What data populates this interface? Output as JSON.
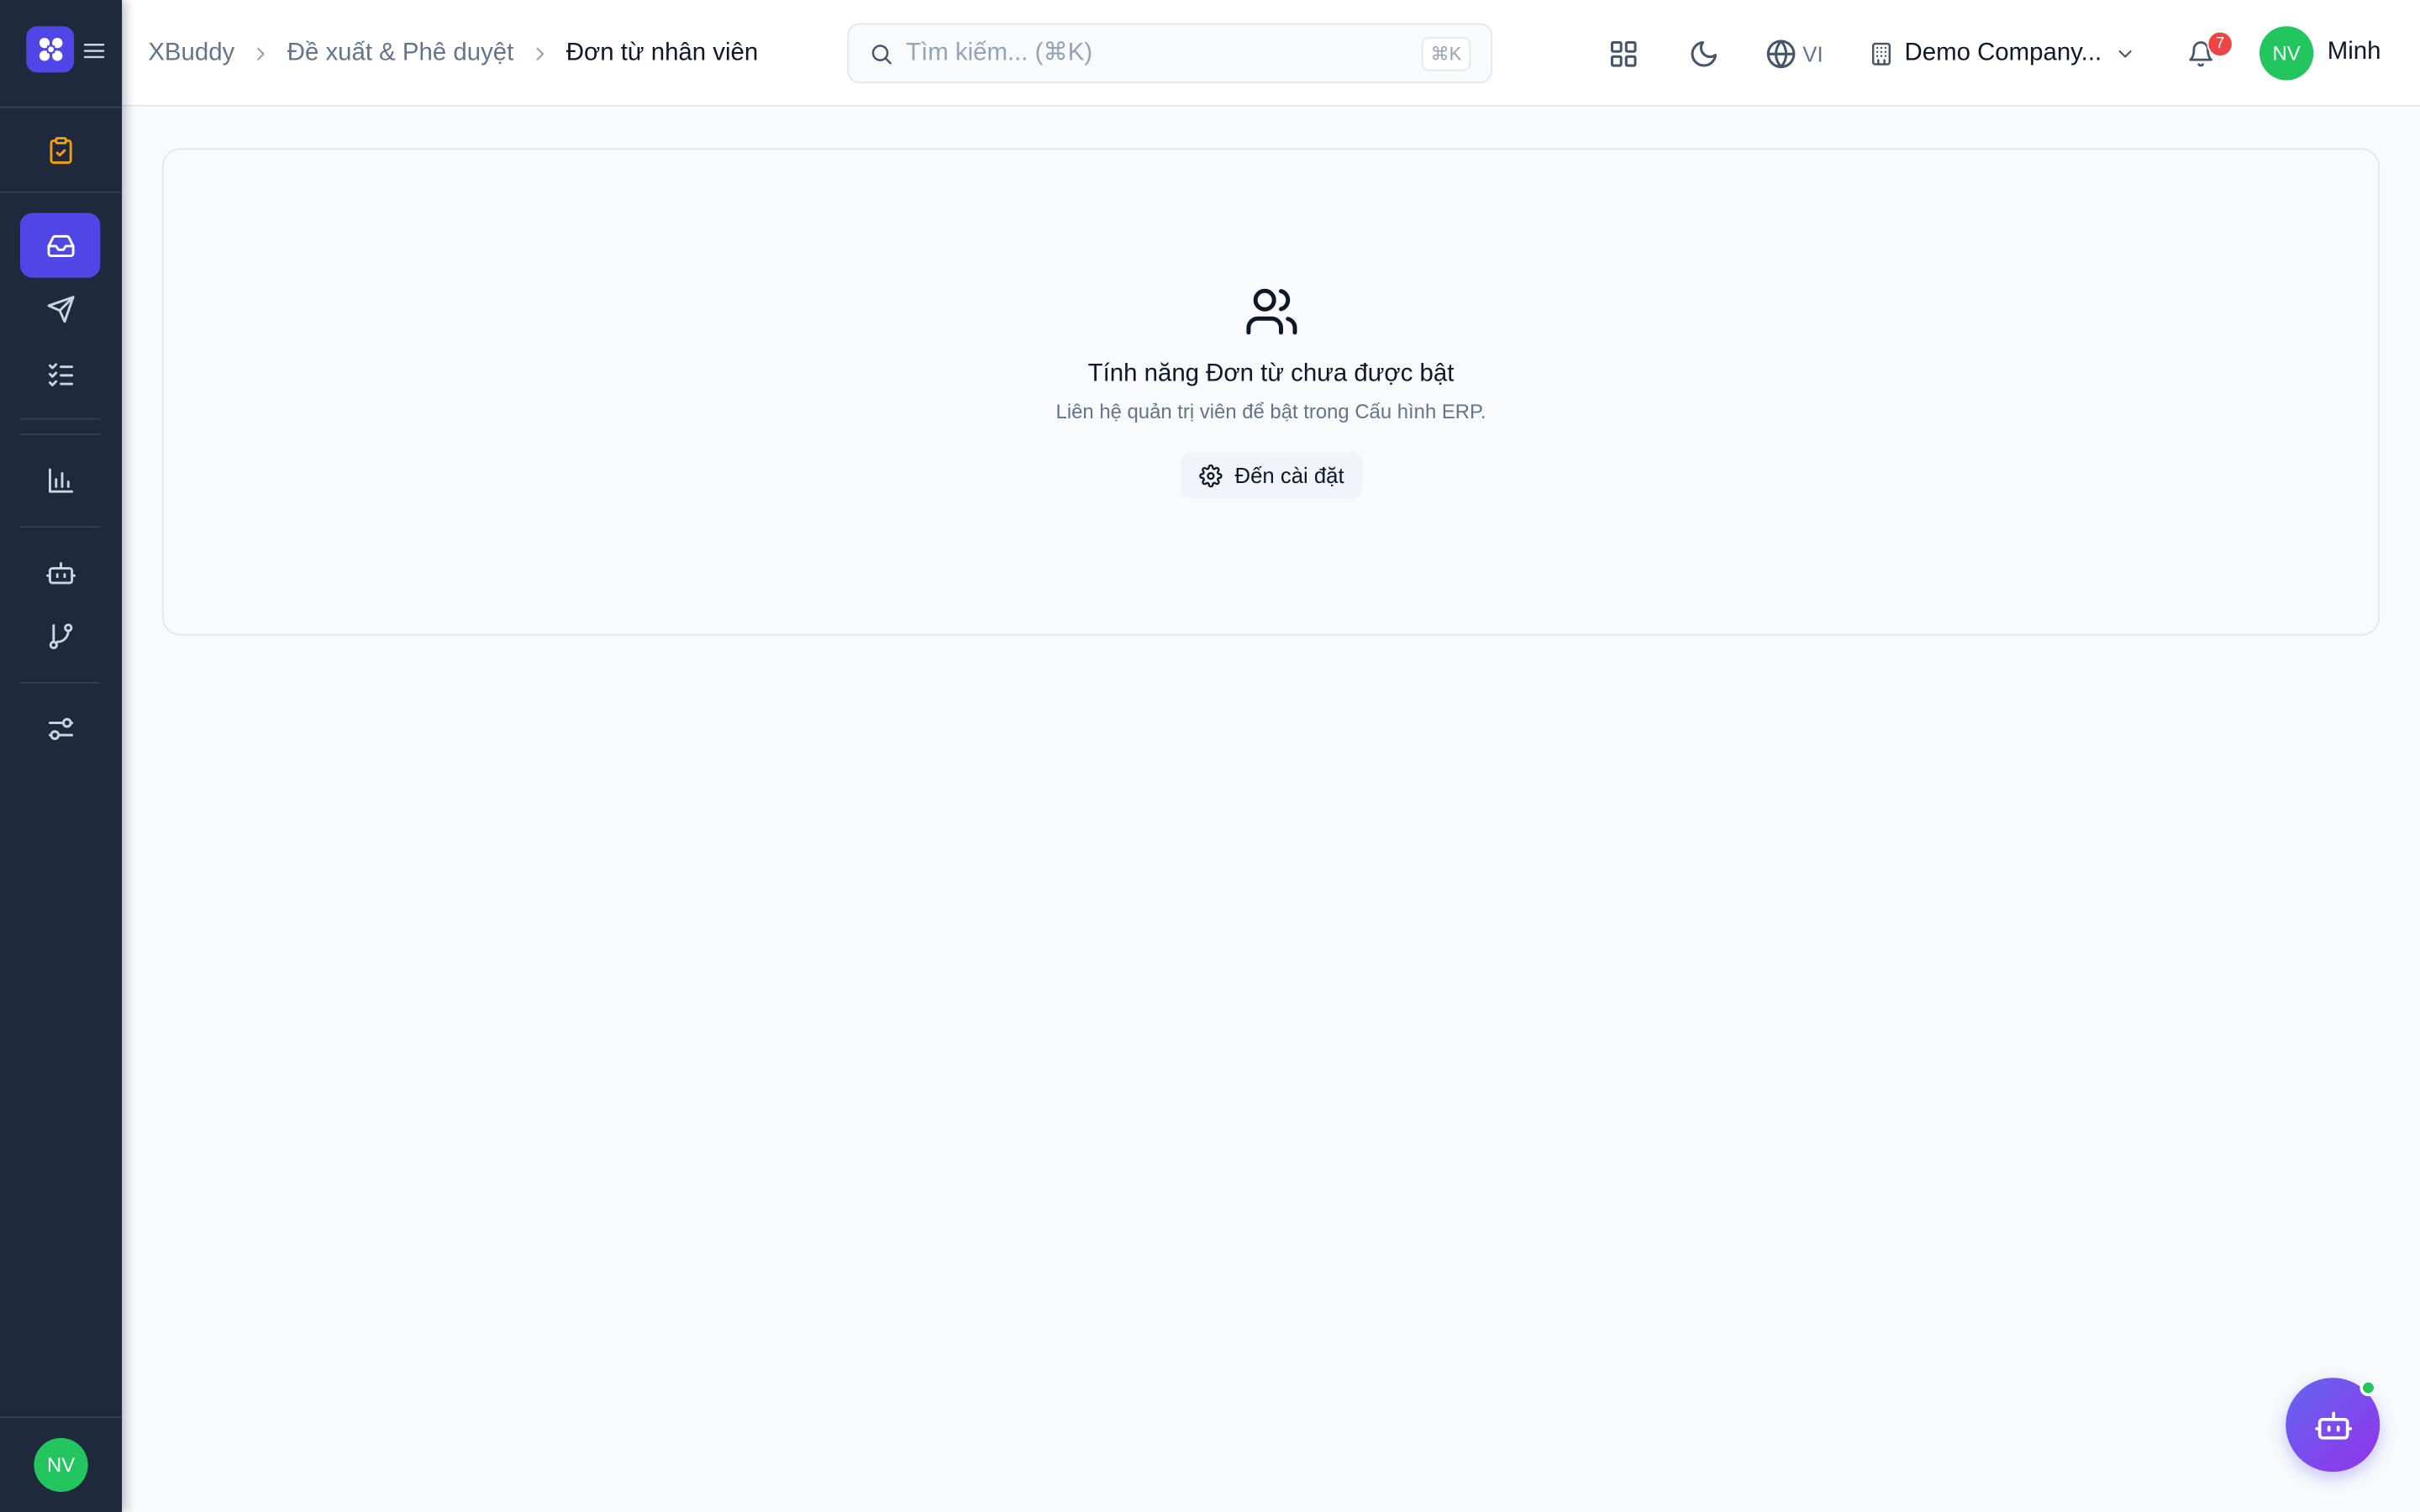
{
  "colors": {
    "sidebar_bg": "#1e293b",
    "accent": "#4f46e5",
    "avatar": "#22c55e",
    "notification_badge": "#ef4444",
    "active_icon_gold": "#f59e0b"
  },
  "sidebar": {
    "logo_icon": "xbuddy-logo-icon",
    "avatar_initials": "NV",
    "items": [
      {
        "icon": "clipboard-check-icon",
        "active": false
      },
      {
        "icon": "inbox-icon",
        "active": true
      },
      {
        "icon": "send-icon",
        "active": false
      },
      {
        "icon": "list-checks-icon",
        "active": false
      },
      {
        "icon": "bar-chart-icon",
        "active": false
      },
      {
        "icon": "bot-icon",
        "active": false
      },
      {
        "icon": "git-branch-icon",
        "active": false
      },
      {
        "icon": "sliders-icon",
        "active": false
      }
    ]
  },
  "header": {
    "breadcrumb": [
      "XBuddy",
      "Đề xuất & Phê duyệt",
      "Đơn từ nhân viên"
    ],
    "search": {
      "placeholder": "Tìm kiếm... (⌘K)",
      "value": "",
      "shortcut": "⌘K"
    },
    "language": "VI",
    "company": "Demo Company...",
    "notifications_count": "7",
    "user": {
      "initials": "NV",
      "name": "Minh"
    }
  },
  "main": {
    "empty_state": {
      "icon": "users-icon",
      "title": "Tính năng Đơn từ chưa được bật",
      "description": "Liên hệ quản trị viên để bật trong Cấu hình ERP.",
      "button_label": "Đến cài đặt"
    }
  },
  "fab": {
    "icon": "bot-icon",
    "online": true
  }
}
